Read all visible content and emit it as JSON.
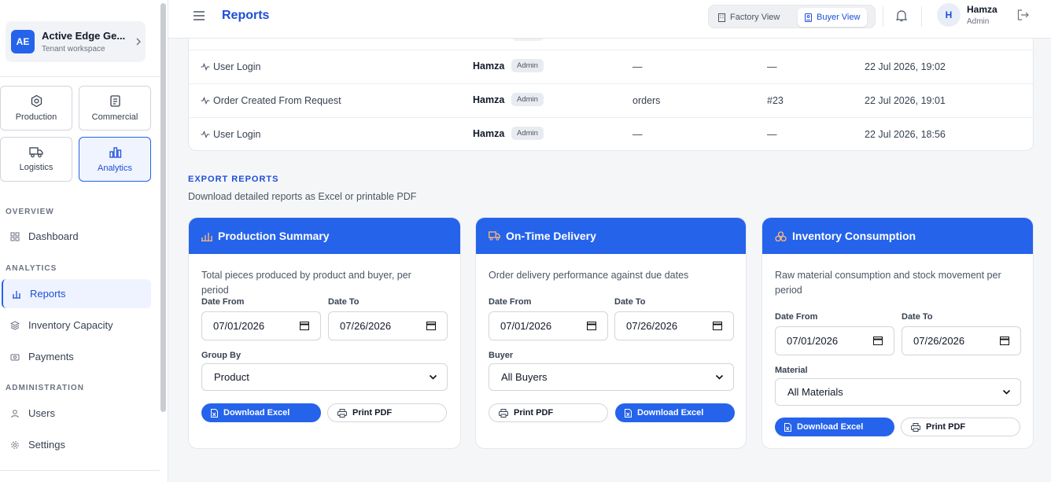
{
  "colors": {
    "accent": "#2563eb",
    "accent_dark": "#1d4ed8",
    "bg": "#f5f6f8"
  },
  "sidebar": {
    "tenant": {
      "initials": "AE",
      "name": "Active Edge Ge...",
      "subtitle": "Tenant workspace"
    },
    "modules": [
      {
        "label": "Production",
        "icon": "hexagon-gear-icon"
      },
      {
        "label": "Commercial",
        "icon": "clipboard-icon"
      },
      {
        "label": "Logistics",
        "icon": "truck-icon"
      },
      {
        "label": "Analytics",
        "icon": "bar-chart-icon",
        "active": true
      }
    ],
    "sections": {
      "overview": "OVERVIEW",
      "analytics": "ANALYTICS",
      "administration": "ADMINISTRATION"
    },
    "nav": {
      "dashboard": "Dashboard",
      "reports": "Reports",
      "inventory_capacity": "Inventory Capacity",
      "payments": "Payments",
      "users": "Users",
      "settings": "Settings"
    }
  },
  "topbar": {
    "title": "Reports",
    "factory_view": "Factory View",
    "buyer_view": "Buyer View",
    "user_initial": "H",
    "user_name": "Hamza",
    "user_role": "Admin"
  },
  "activity": {
    "rows": [
      {
        "action": "User Login",
        "user": "Hamza",
        "role": "Admin",
        "module": "—",
        "record": "—",
        "time": "22 Jul 2026, 19:02"
      },
      {
        "action": "Order Created From Request",
        "user": "Hamza",
        "role": "Admin",
        "module": "orders",
        "record": "#23",
        "time": "22 Jul 2026, 19:01"
      },
      {
        "action": "User Login",
        "user": "Hamza",
        "role": "Admin",
        "module": "—",
        "record": "—",
        "time": "22 Jul 2026, 18:56"
      }
    ]
  },
  "export": {
    "title": "EXPORT REPORTS",
    "subtitle": "Download detailed reports as Excel or printable PDF",
    "cards": [
      {
        "title": "Production Summary",
        "description": "Total pieces produced by product and buyer, per period",
        "date_from_label": "Date From",
        "date_from": "07/01/2026",
        "date_to_label": "Date To",
        "date_to": "07/26/2026",
        "select_label": "Group By",
        "select_value": "Product",
        "excel_label": "Download Excel",
        "pdf_label": "Print PDF"
      },
      {
        "title": "On-Time Delivery",
        "description": "Order delivery performance against due dates",
        "date_from_label": "Date From",
        "date_from": "07/01/2026",
        "date_to_label": "Date To",
        "date_to": "07/26/2026",
        "select_label": "Buyer",
        "select_value": "All Buyers",
        "excel_label": "Download Excel",
        "pdf_label": "Print PDF"
      },
      {
        "title": "Inventory Consumption",
        "description": "Raw material consumption and stock movement per period",
        "date_from_label": "Date From",
        "date_from": "07/01/2026",
        "date_to_label": "Date To",
        "date_to": "07/26/2026",
        "select_label": "Material",
        "select_value": "All Materials",
        "excel_label": "Download Excel",
        "pdf_label": "Print PDF"
      }
    ]
  }
}
